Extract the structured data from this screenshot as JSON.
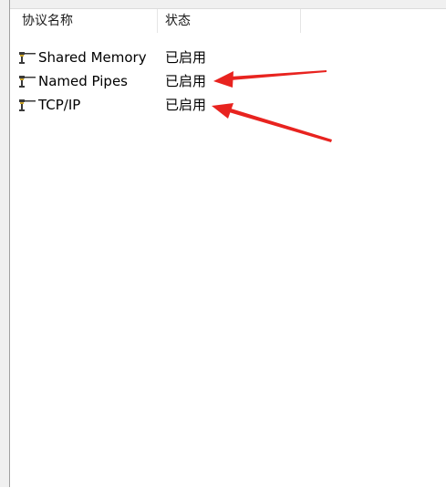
{
  "columns": {
    "name": "协议名称",
    "status": "状态"
  },
  "rows": [
    {
      "name": "Shared Memory",
      "status": "已启用",
      "icon": "protocol-icon"
    },
    {
      "name": "Named Pipes",
      "status": "已启用",
      "icon": "protocol-icon"
    },
    {
      "name": "TCP/IP",
      "status": "已启用",
      "icon": "protocol-icon"
    }
  ],
  "annotations": {
    "arrow_color": "#e8231f",
    "arrows": [
      "arrow-to-named-pipes-status",
      "arrow-to-tcpip-status"
    ]
  }
}
